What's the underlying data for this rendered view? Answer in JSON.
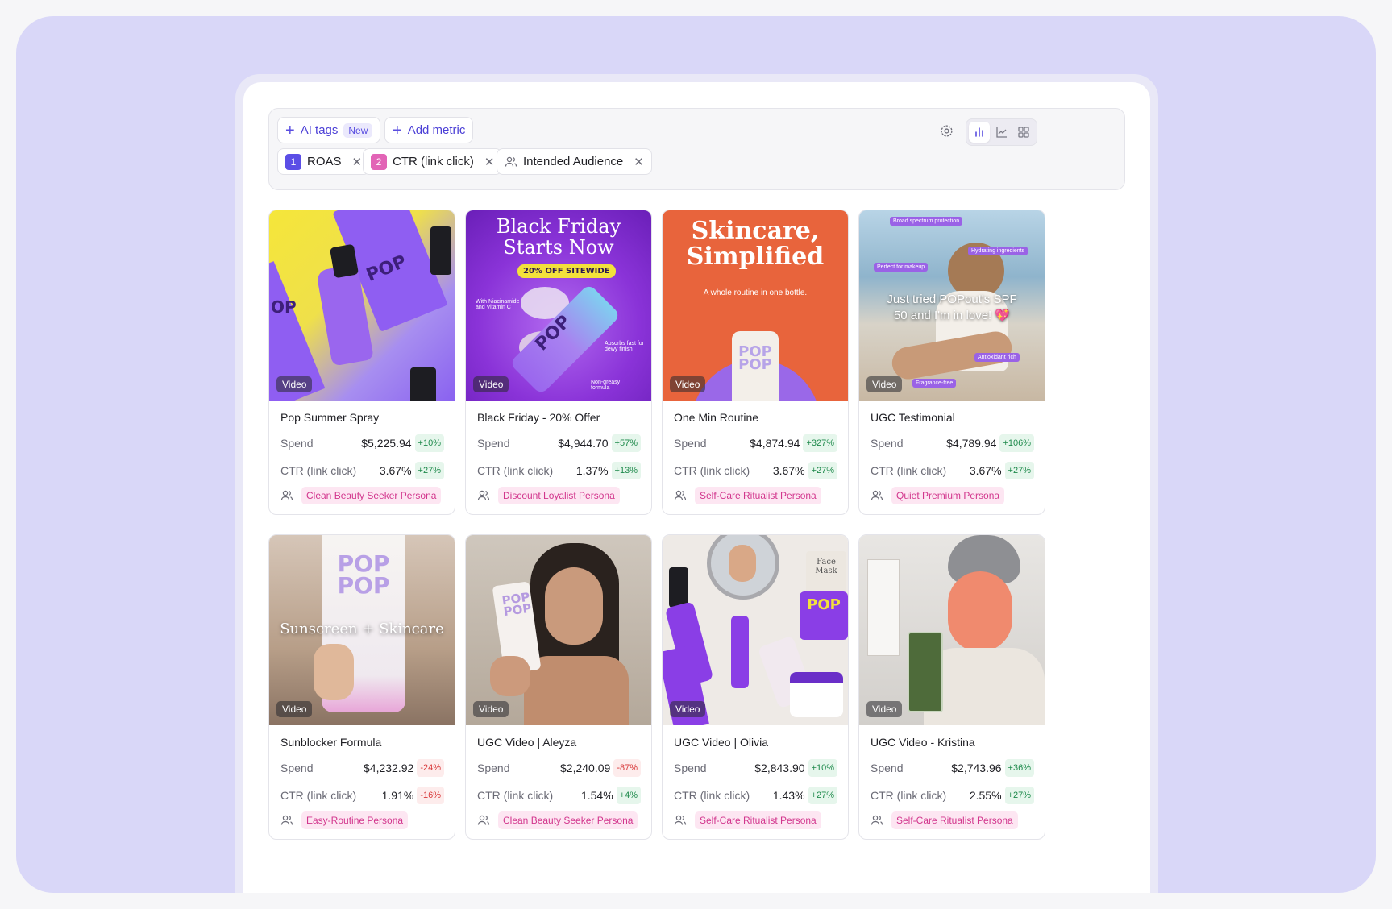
{
  "toolbar": {
    "ai_tags": "AI tags",
    "new_badge": "New",
    "add_metric": "Add metric",
    "filters": [
      {
        "num": "1",
        "label": "ROAS",
        "color": "#5b4ee6"
      },
      {
        "num": "2",
        "label": "CTR (link click)",
        "color": "#e264b6"
      },
      {
        "num": "",
        "label": "Intended Audience",
        "color": ""
      }
    ]
  },
  "cards": [
    {
      "badge": "Video",
      "title": "Pop Summer Spray",
      "spend_label": "Spend",
      "spend": "$5,225.94",
      "spend_delta": "+10%",
      "ctr_label": "CTR (link click)",
      "ctr": "3.67%",
      "ctr_delta": "+27%",
      "persona": "Clean Beauty Seeker Persona"
    },
    {
      "badge": "Video",
      "title": "Black Friday - 20% Offer",
      "spend_label": "Spend",
      "spend": "$4,944.70",
      "spend_delta": "+57%",
      "ctr_label": "CTR (link click)",
      "ctr": "1.37%",
      "ctr_delta": "+13%",
      "persona": "Discount Loyalist Persona"
    },
    {
      "badge": "Video",
      "title": "One Min Routine",
      "spend_label": "Spend",
      "spend": "$4,874.94",
      "spend_delta": "+327%",
      "ctr_label": "CTR (link click)",
      "ctr": "3.67%",
      "ctr_delta": "+27%",
      "persona": "Self-Care Ritualist Persona"
    },
    {
      "badge": "Video",
      "title": "UGC Testimonial",
      "spend_label": "Spend",
      "spend": "$4,789.94",
      "spend_delta": "+106%",
      "ctr_label": "CTR (link click)",
      "ctr": "3.67%",
      "ctr_delta": "+27%",
      "persona": "Quiet Premium Persona"
    },
    {
      "badge": "Video",
      "title": "Sunblocker Formula",
      "spend_label": "Spend",
      "spend": "$4,232.92",
      "spend_delta": "-24%",
      "ctr_label": "CTR (link click)",
      "ctr": "1.91%",
      "ctr_delta": "-16%",
      "persona": "Easy-Routine Persona"
    },
    {
      "badge": "Video",
      "title": "UGC Video | Aleyza",
      "spend_label": "Spend",
      "spend": "$2,240.09",
      "spend_delta": "-87%",
      "ctr_label": "CTR (link click)",
      "ctr": "1.54%",
      "ctr_delta": "+4%",
      "persona": "Clean Beauty Seeker Persona"
    },
    {
      "badge": "Video",
      "title": "UGC Video | Olivia",
      "spend_label": "Spend",
      "spend": "$2,843.90",
      "spend_delta": "+10%",
      "ctr_label": "CTR (link click)",
      "ctr": "1.43%",
      "ctr_delta": "+27%",
      "persona": "Self-Care Ritualist Persona"
    },
    {
      "badge": "Video",
      "title": "UGC Video - Kristina",
      "spend_label": "Spend",
      "spend": "$2,743.96",
      "spend_delta": "+36%",
      "ctr_label": "CTR (link click)",
      "ctr": "2.55%",
      "ctr_delta": "+27%",
      "persona": "Self-Care Ritualist Persona"
    }
  ],
  "thumbs": {
    "c0": {
      "brand": "POP",
      "brand2": "OP"
    },
    "c1": {
      "line1": "Black Friday",
      "line2": "Starts Now",
      "offer": "20% OFF SITEWIDE",
      "note1": "With Niacinamide and Vitamin C",
      "note2": "Absorbs fast for dewy finish",
      "note3": "Non-greasy formula",
      "brand": "POP"
    },
    "c2": {
      "line1": "Skincare,",
      "line2": "Simplified",
      "sub": "A whole routine in one bottle.",
      "brand": "POP",
      "brand2": "POP"
    },
    "c3": {
      "quote1": "Just tried POPout's SPF",
      "quote2": "50 and I'm in love! 💖",
      "tag1": "Broad spectrum protection",
      "tag2": "Hydrating ingredients",
      "tag3": "Perfect for makeup",
      "tag4": "Antioxidant rich",
      "tag5": "Fragrance-free"
    },
    "c4": {
      "brand": "POP",
      "brand2": "POP",
      "overlay": "Sunscreen + Skincare"
    },
    "c5": {
      "brand": "POP",
      "brand2": "POP"
    },
    "c6": {
      "brand": "POP",
      "mask1": "Face",
      "mask2": "Mask"
    },
    "c7": {}
  }
}
